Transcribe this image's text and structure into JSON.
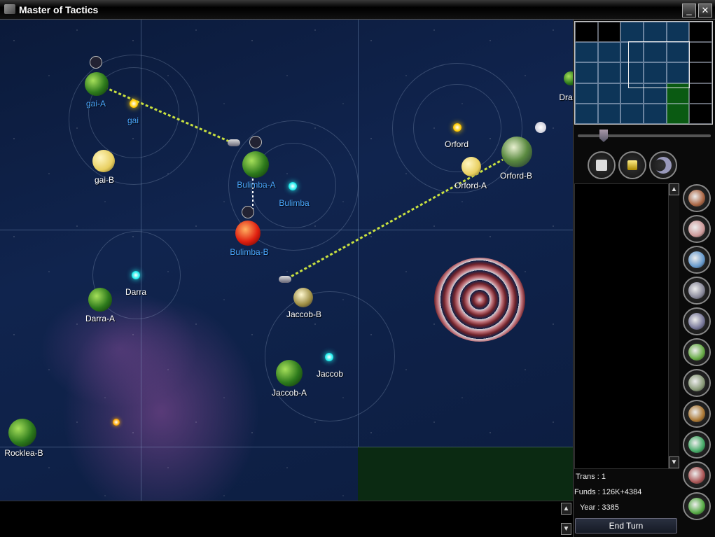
{
  "window": {
    "title": "Master of Tactics",
    "minimize_label": "_",
    "close_label": "✕"
  },
  "map": {
    "labels": {
      "gai_a": "gai-A",
      "gai": "gai",
      "gai_b": "gai-B",
      "bulimba_a": "Bulimba-A",
      "bulimba": "Bulimba",
      "bulimba_b": "Bulimba-B",
      "orford": "Orford",
      "orford_a": "Orford-A",
      "orford_b": "Orford-B",
      "dra": "Dra",
      "darra": "Darra",
      "darra_a": "Darra-A",
      "jaccob_b": "Jaccob-B",
      "jaccob": "Jaccob",
      "jaccob_a": "Jaccob-A",
      "rocklea_b": "Rocklea-B"
    },
    "colors": {
      "owned_label": "#4aa8ff",
      "neutral_label": "#ffffff",
      "route": "#c8e040"
    }
  },
  "minimap": {
    "cells": [
      [
        "black",
        "black",
        "blue",
        "blue",
        "blue",
        "black"
      ],
      [
        "blue",
        "blue",
        "blue",
        "blue",
        "blue",
        "black"
      ],
      [
        "blue",
        "blue",
        "blue",
        "blue",
        "blue",
        "black"
      ],
      [
        "blue",
        "blue",
        "blue",
        "blue",
        "green",
        "black"
      ],
      [
        "blue",
        "blue",
        "blue",
        "blue",
        "green",
        "black"
      ]
    ],
    "zoom_level": 0.2
  },
  "toolbar": {
    "icons": [
      "save-icon",
      "crown-icon",
      "ship-icon"
    ]
  },
  "side_buttons": [
    "factory-icon",
    "research-icon",
    "flask-icon",
    "robot-icon",
    "ship-design-icon",
    "planets-icon",
    "population-icon",
    "transfer-icon",
    "planet-attack-icon",
    "production-icon",
    "colonize-icon"
  ],
  "stats": {
    "trans": "Trans : 1",
    "funds": "Funds : 126K+4384",
    "year": "Year : 3385"
  },
  "end_turn": "End Turn",
  "scroll": {
    "up": "▲",
    "down": "▼"
  }
}
